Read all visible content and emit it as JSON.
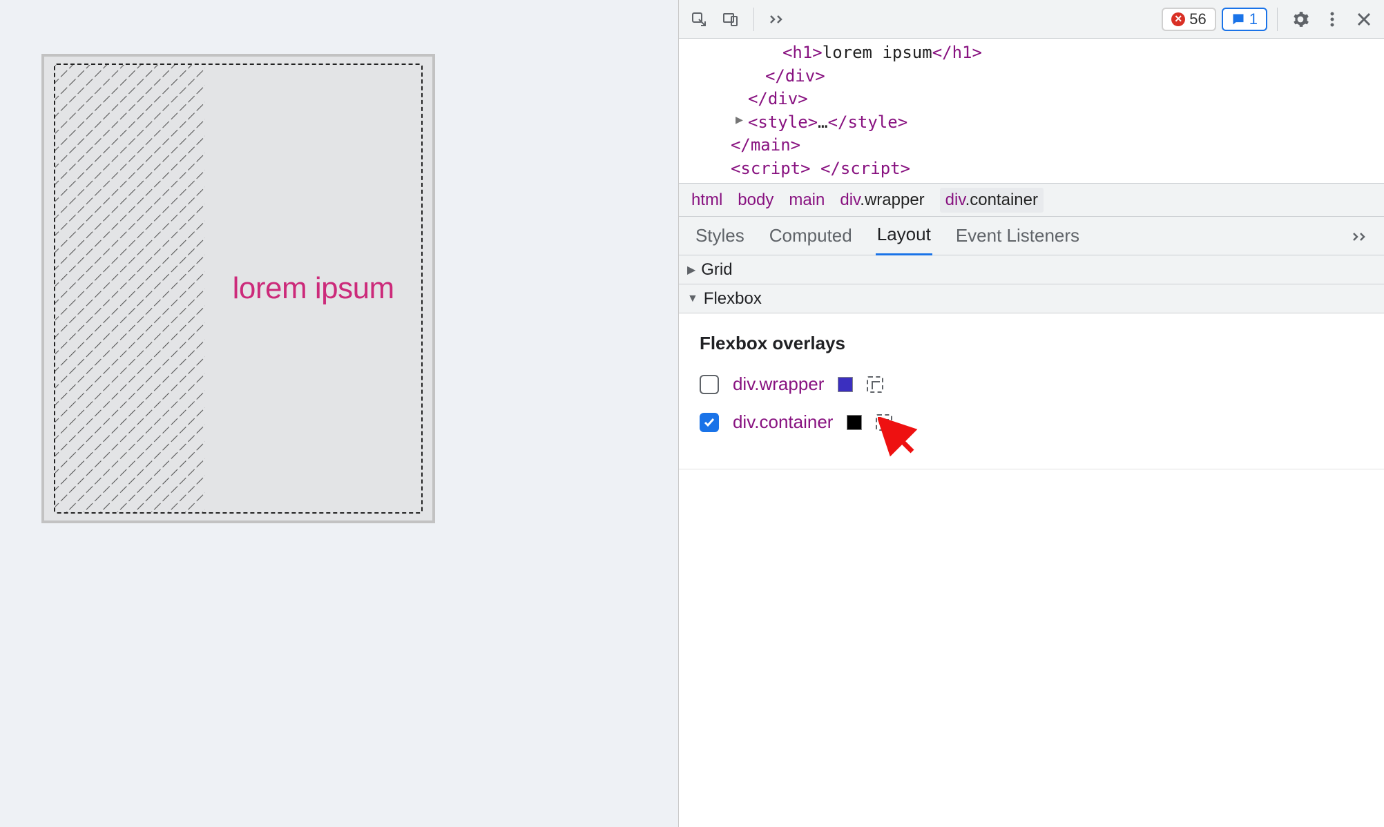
{
  "preview": {
    "heading": "lorem ipsum"
  },
  "toolbar": {
    "errors": "56",
    "messages": "1"
  },
  "dom": {
    "line1_open": "<h1>",
    "line1_text": "lorem ipsum",
    "line1_close": "</h1>",
    "line2": "</div>",
    "line3": "</div>",
    "line4a": "<style>",
    "line4b": "…",
    "line4c": "</style>",
    "line5": "</main>",
    "line6": "<script> </script>"
  },
  "crumbs": {
    "c1": "html",
    "c2": "body",
    "c3": "main",
    "c4a": "div",
    "c4b": ".wrapper",
    "c5a": "div",
    "c5b": ".container"
  },
  "subtabs": {
    "t1": "Styles",
    "t2": "Computed",
    "t3": "Layout",
    "t4": "Event Listeners"
  },
  "sections": {
    "grid": "Grid",
    "flexbox": "Flexbox"
  },
  "flexpanel": {
    "title": "Flexbox overlays",
    "row1_label": "div.wrapper",
    "row2_label": "div.container"
  }
}
